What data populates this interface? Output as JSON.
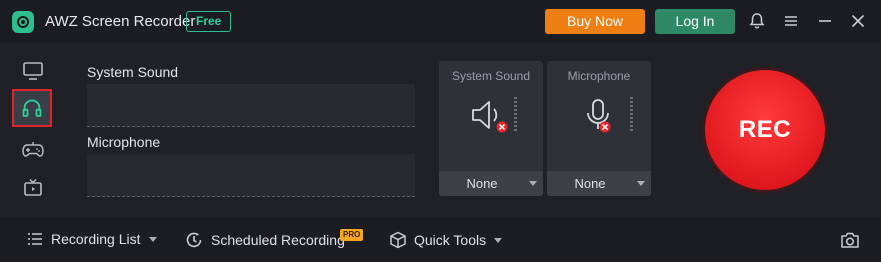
{
  "app": {
    "title": "AWZ Screen Recorder",
    "badge": "Free",
    "buy_now": "Buy Now",
    "log_in": "Log In"
  },
  "audio": {
    "system_sound_label": "System Sound",
    "microphone_label": "Microphone"
  },
  "devices": {
    "system_sound": {
      "title": "System Sound",
      "value": "None"
    },
    "microphone": {
      "title": "Microphone",
      "value": "None"
    }
  },
  "rec_label": "REC",
  "bottom": {
    "recording_list": "Recording List",
    "scheduled_recording": "Scheduled Recording",
    "pro_badge": "PRO",
    "quick_tools": "Quick Tools"
  },
  "colors": {
    "accent_green": "#2fbf8f",
    "buy_orange": "#f07f13",
    "login_green": "#2e8a66",
    "rec_red": "#e0181f",
    "selected_border": "#e3262c"
  }
}
